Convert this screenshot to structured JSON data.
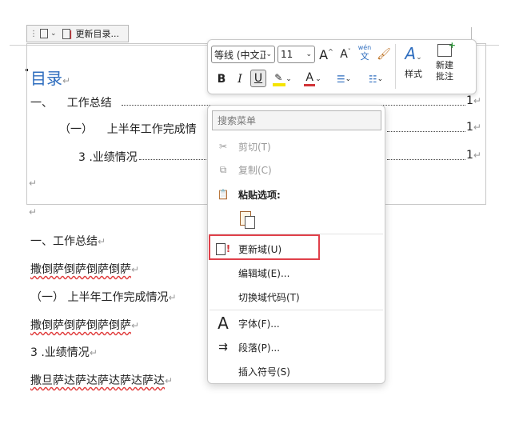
{
  "toc_control": {
    "update_label": "更新目录..."
  },
  "document": {
    "toc_title": "目录",
    "toc_entries": [
      {
        "text": "一、    工作总结",
        "page": "1"
      },
      {
        "text": "（一）    上半年工作完成情",
        "page": "1"
      },
      {
        "text": "3 .业绩情况",
        "page": "1"
      }
    ],
    "paragraphs": [
      "一、工作总结",
      "撒倒萨倒萨倒萨倒萨",
      "（一） 上半年工作完成情况",
      "撒倒萨倒萨倒萨倒萨",
      "3 .业绩情况",
      "撒旦萨达萨达萨达萨达萨达"
    ]
  },
  "mini_toolbar": {
    "font_name": "等线 (中文正",
    "font_size": "11",
    "grow_font": "A",
    "shrink_font": "A",
    "phonetic_top": "wén",
    "phonetic_bottom": "文",
    "bold": "B",
    "italic": "I",
    "underline": "U",
    "font_color_letter": "A",
    "styles_label": "样式",
    "new_comment_line1": "新建",
    "new_comment_line2": "批注",
    "highlight_color": "#f5e400",
    "font_color": "#d13438"
  },
  "context_menu": {
    "search_placeholder": "搜索菜单",
    "cut": "剪切(T)",
    "copy": "复制(C)",
    "paste_options": "粘贴选项:",
    "update_field": "更新域(U)",
    "edit_field": "编辑域(E)...",
    "toggle_field_codes": "切换域代码(T)",
    "font": "字体(F)...",
    "paragraph": "段落(P)...",
    "insert_symbol": "插入符号(S)",
    "highlight_color": "#e0404a"
  }
}
